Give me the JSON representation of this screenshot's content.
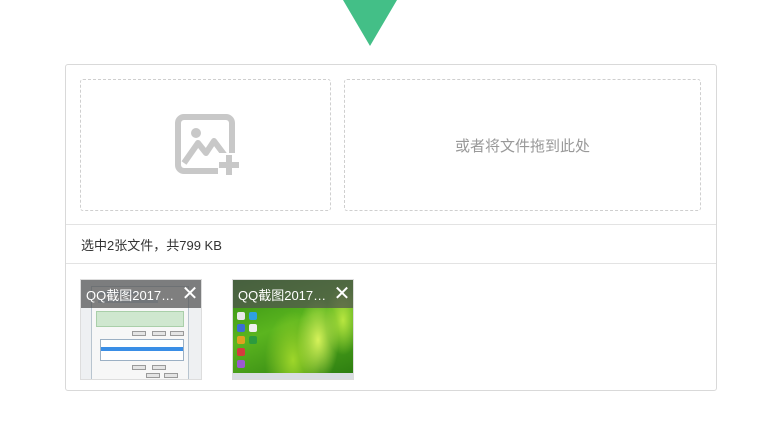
{
  "uploader": {
    "pick_icon": "image-add-icon",
    "drop_hint": "或者将文件拖到此处",
    "status_text": "选中2张文件，共799 KB",
    "files": [
      {
        "name": "QQ截图20170…",
        "close_icon": "close-icon"
      },
      {
        "name": "QQ截图20170…",
        "close_icon": "close-icon"
      }
    ]
  },
  "colors": {
    "accent": "#43bf87",
    "border": "#d9d9d9",
    "dashed": "#cfcfcf",
    "icon": "#c8c8c8",
    "hint": "#999999"
  }
}
